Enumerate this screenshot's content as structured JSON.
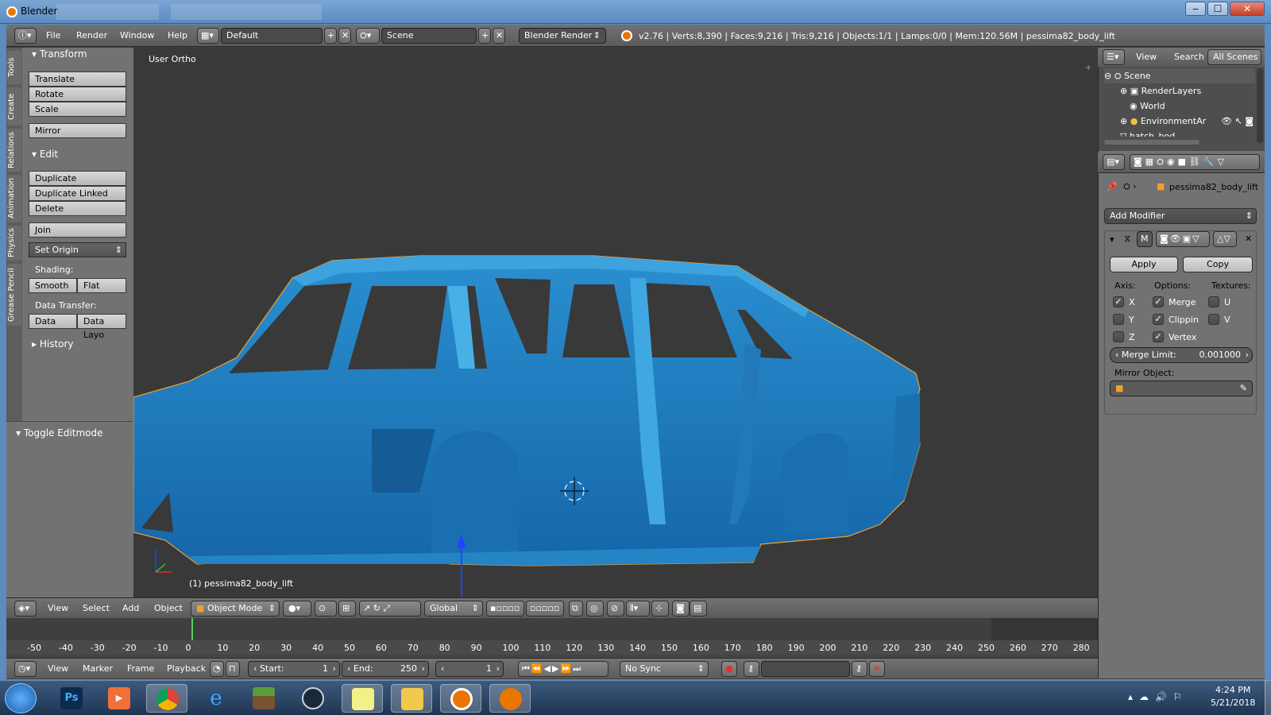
{
  "window": {
    "title": "Blender",
    "min": "‒",
    "max": "☐",
    "close": "✕"
  },
  "infobar": {
    "menus": [
      "File",
      "Render",
      "Window",
      "Help"
    ],
    "layout": "Default",
    "scene": "Scene",
    "engine": "Blender Render",
    "stats": "v2.76 | Verts:8,390 | Faces:9,216 | Tris:9,216 | Objects:1/1 | Lamps:0/0 | Mem:120.56M | pessima82_body_lift"
  },
  "toolshelf": {
    "vtabs": [
      "Tools",
      "Create",
      "Relations",
      "Animation",
      "Physics",
      "Grease Pencil"
    ],
    "transform": {
      "title": "Transform",
      "buttons": [
        "Translate",
        "Rotate",
        "Scale"
      ],
      "mirror": "Mirror"
    },
    "edit": {
      "title": "Edit",
      "buttons": [
        "Duplicate",
        "Duplicate Linked",
        "Delete"
      ],
      "join": "Join",
      "set_origin": "Set Origin"
    },
    "shading": {
      "label": "Shading:",
      "smooth": "Smooth",
      "flat": "Flat"
    },
    "data_transfer": {
      "label": "Data Transfer:",
      "data": "Data",
      "data_layout": "Data Layo"
    },
    "history": "History",
    "toggle_editmode": "Toggle Editmode"
  },
  "viewport": {
    "view_label": "User Ortho",
    "object_label": "(1) pessima82_body_lift"
  },
  "view3d_header": {
    "menus": [
      "View",
      "Select",
      "Add",
      "Object"
    ],
    "mode": "Object Mode",
    "orientation": "Global"
  },
  "timeline": {
    "ticks": [
      "-50",
      "-40",
      "-30",
      "-20",
      "-10",
      "0",
      "10",
      "20",
      "30",
      "40",
      "50",
      "60",
      "70",
      "80",
      "90",
      "100",
      "110",
      "120",
      "130",
      "140",
      "150",
      "160",
      "170",
      "180",
      "190",
      "200",
      "210",
      "220",
      "230",
      "240",
      "250",
      "260",
      "270",
      "280"
    ],
    "menus": [
      "View",
      "Marker",
      "Frame",
      "Playback"
    ],
    "start_label": "Start:",
    "start": "1",
    "end_label": "End:",
    "end": "250",
    "current": "1",
    "sync": "No Sync"
  },
  "outliner": {
    "tabs": [
      "View",
      "Search",
      "All Scenes"
    ],
    "rows": [
      "Scene",
      "RenderLayers",
      "World",
      "EnvironmentAr",
      "hatch_bod"
    ]
  },
  "properties": {
    "object_name": "pessima82_body_lift",
    "add_modifier": "Add Modifier",
    "modifier_name": "M",
    "apply": "Apply",
    "copy": "Copy",
    "axis_label": "Axis:",
    "options_label": "Options:",
    "textures_label": "Textures:",
    "axis": [
      {
        "label": "X",
        "checked": true
      },
      {
        "label": "Y",
        "checked": false
      },
      {
        "label": "Z",
        "checked": false
      }
    ],
    "options": [
      {
        "label": "Merge",
        "checked": true
      },
      {
        "label": "Clippin",
        "checked": true
      },
      {
        "label": "Vertex",
        "checked": true
      }
    ],
    "textures": [
      {
        "label": "U",
        "checked": false
      },
      {
        "label": "V",
        "checked": false
      }
    ],
    "merge_limit_label": "Merge Limit:",
    "merge_limit": "0.001000",
    "mirror_object_label": "Mirror Object:"
  },
  "taskbar": {
    "apps": [
      "windows-start",
      "photoshop",
      "media-player",
      "chrome",
      "internet-explorer",
      "minecraft",
      "steam",
      "notepad",
      "file-explorer",
      "blender",
      "blender-alt"
    ],
    "time": "4:24 PM",
    "date": "5/21/2018"
  },
  "colors": {
    "accent": "#ea7600",
    "mesh": "#1f7fc0",
    "selection_outline": "#f0a030"
  }
}
